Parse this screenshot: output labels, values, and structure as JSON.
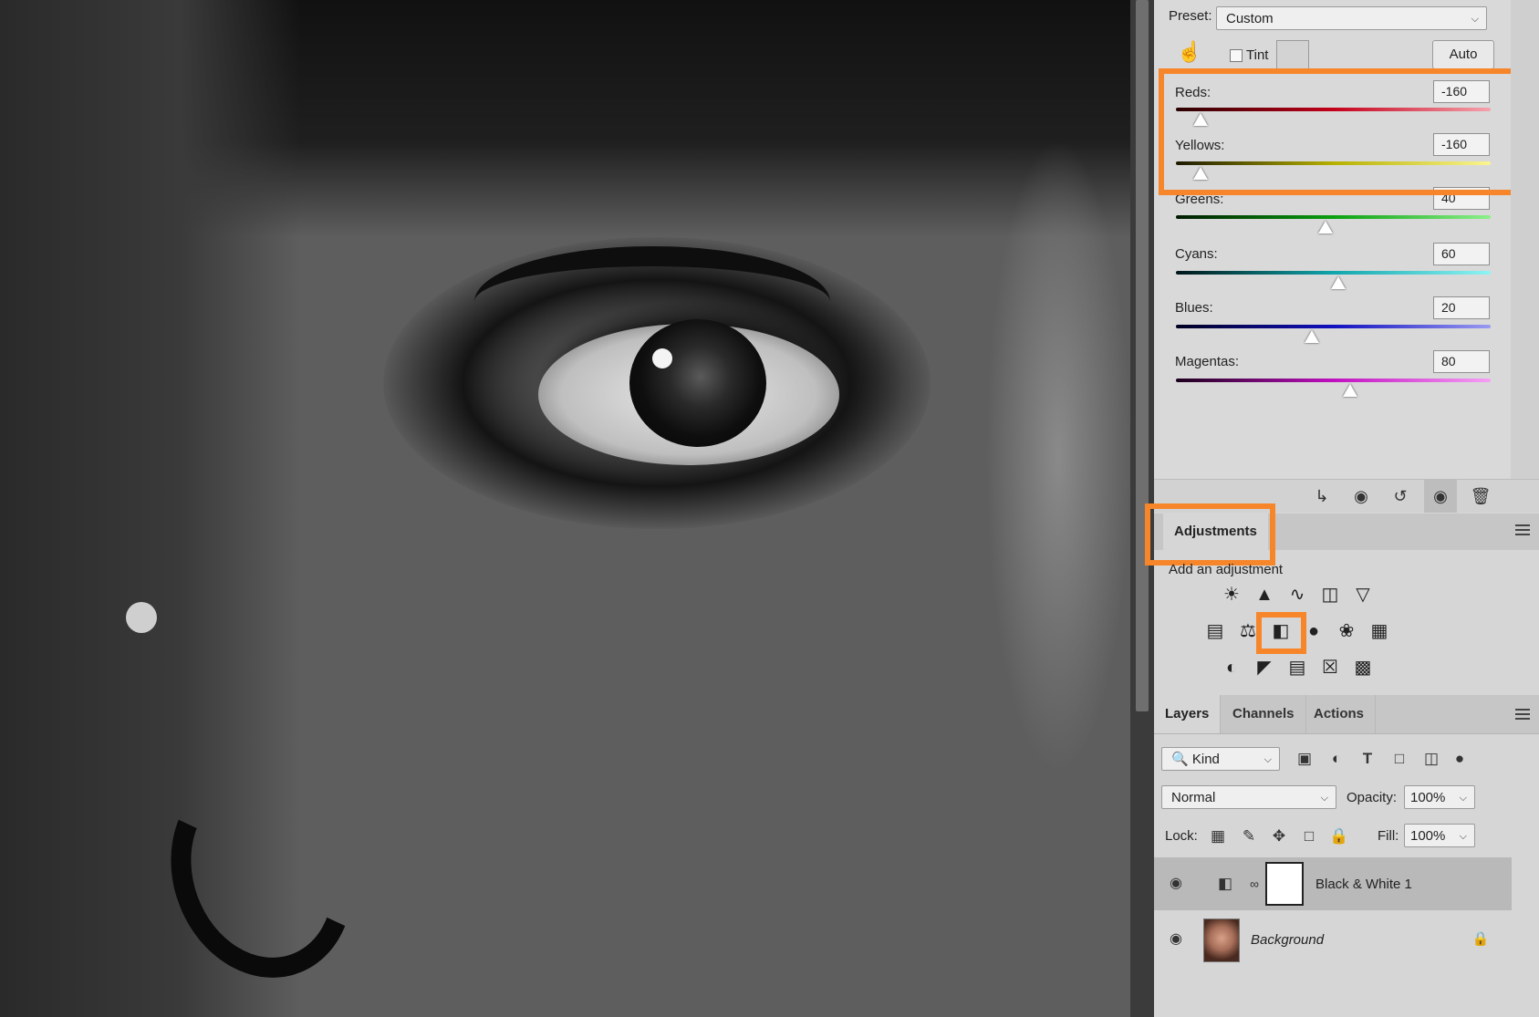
{
  "properties": {
    "preset_label": "Preset:",
    "preset_value": "Custom",
    "tint_label": "Tint",
    "auto_label": "Auto",
    "sliders": [
      {
        "label": "Reds:",
        "value": "-160"
      },
      {
        "label": "Yellows:",
        "value": "-160"
      },
      {
        "label": "Greens:",
        "value": "40"
      },
      {
        "label": "Cyans:",
        "value": "60"
      },
      {
        "label": "Blues:",
        "value": "20"
      },
      {
        "label": "Magentas:",
        "value": "80"
      }
    ]
  },
  "adjustments": {
    "tab_label": "Adjustments",
    "subtitle": "Add an adjustment",
    "icons_row1": [
      "brightness-contrast-icon",
      "levels-icon",
      "curves-icon",
      "exposure-icon",
      "vibrance-icon"
    ],
    "icons_row2": [
      "hue-saturation-icon",
      "color-balance-icon",
      "black-white-icon",
      "photo-filter-icon",
      "channel-mixer-icon",
      "color-lookup-icon"
    ],
    "icons_row3": [
      "invert-icon",
      "posterize-icon",
      "threshold-icon",
      "selective-color-icon",
      "gradient-map-icon"
    ]
  },
  "layers_panel": {
    "tabs": [
      "Layers",
      "Channels",
      "Actions"
    ],
    "filter_kind": "Kind",
    "blend_mode": "Normal",
    "opacity_label": "Opacity:",
    "opacity_value": "100%",
    "lock_label": "Lock:",
    "fill_label": "Fill:",
    "fill_value": "100%",
    "layers": [
      {
        "name": "Black & White 1",
        "selected": true
      },
      {
        "name": "Background",
        "locked": true
      }
    ]
  },
  "highlight_color": "#f7862a"
}
